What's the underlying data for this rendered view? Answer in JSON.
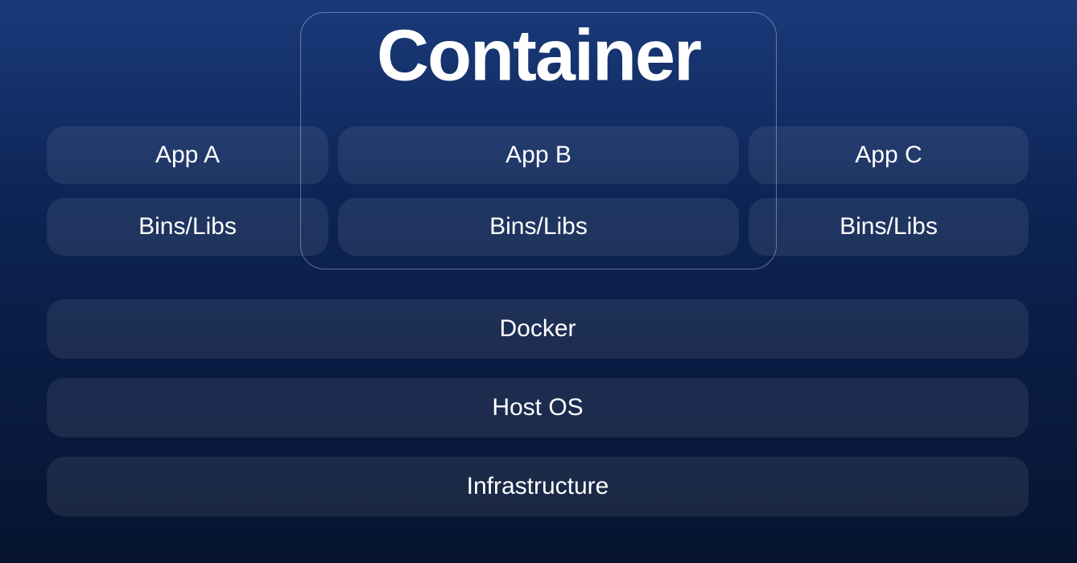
{
  "title": "Container",
  "apps": [
    "App A",
    "App B",
    "App C"
  ],
  "bins": [
    "Bins/Libs",
    "Bins/Libs",
    "Bins/Libs"
  ],
  "layers": [
    "Docker",
    "Host OS",
    "Infrastructure"
  ]
}
